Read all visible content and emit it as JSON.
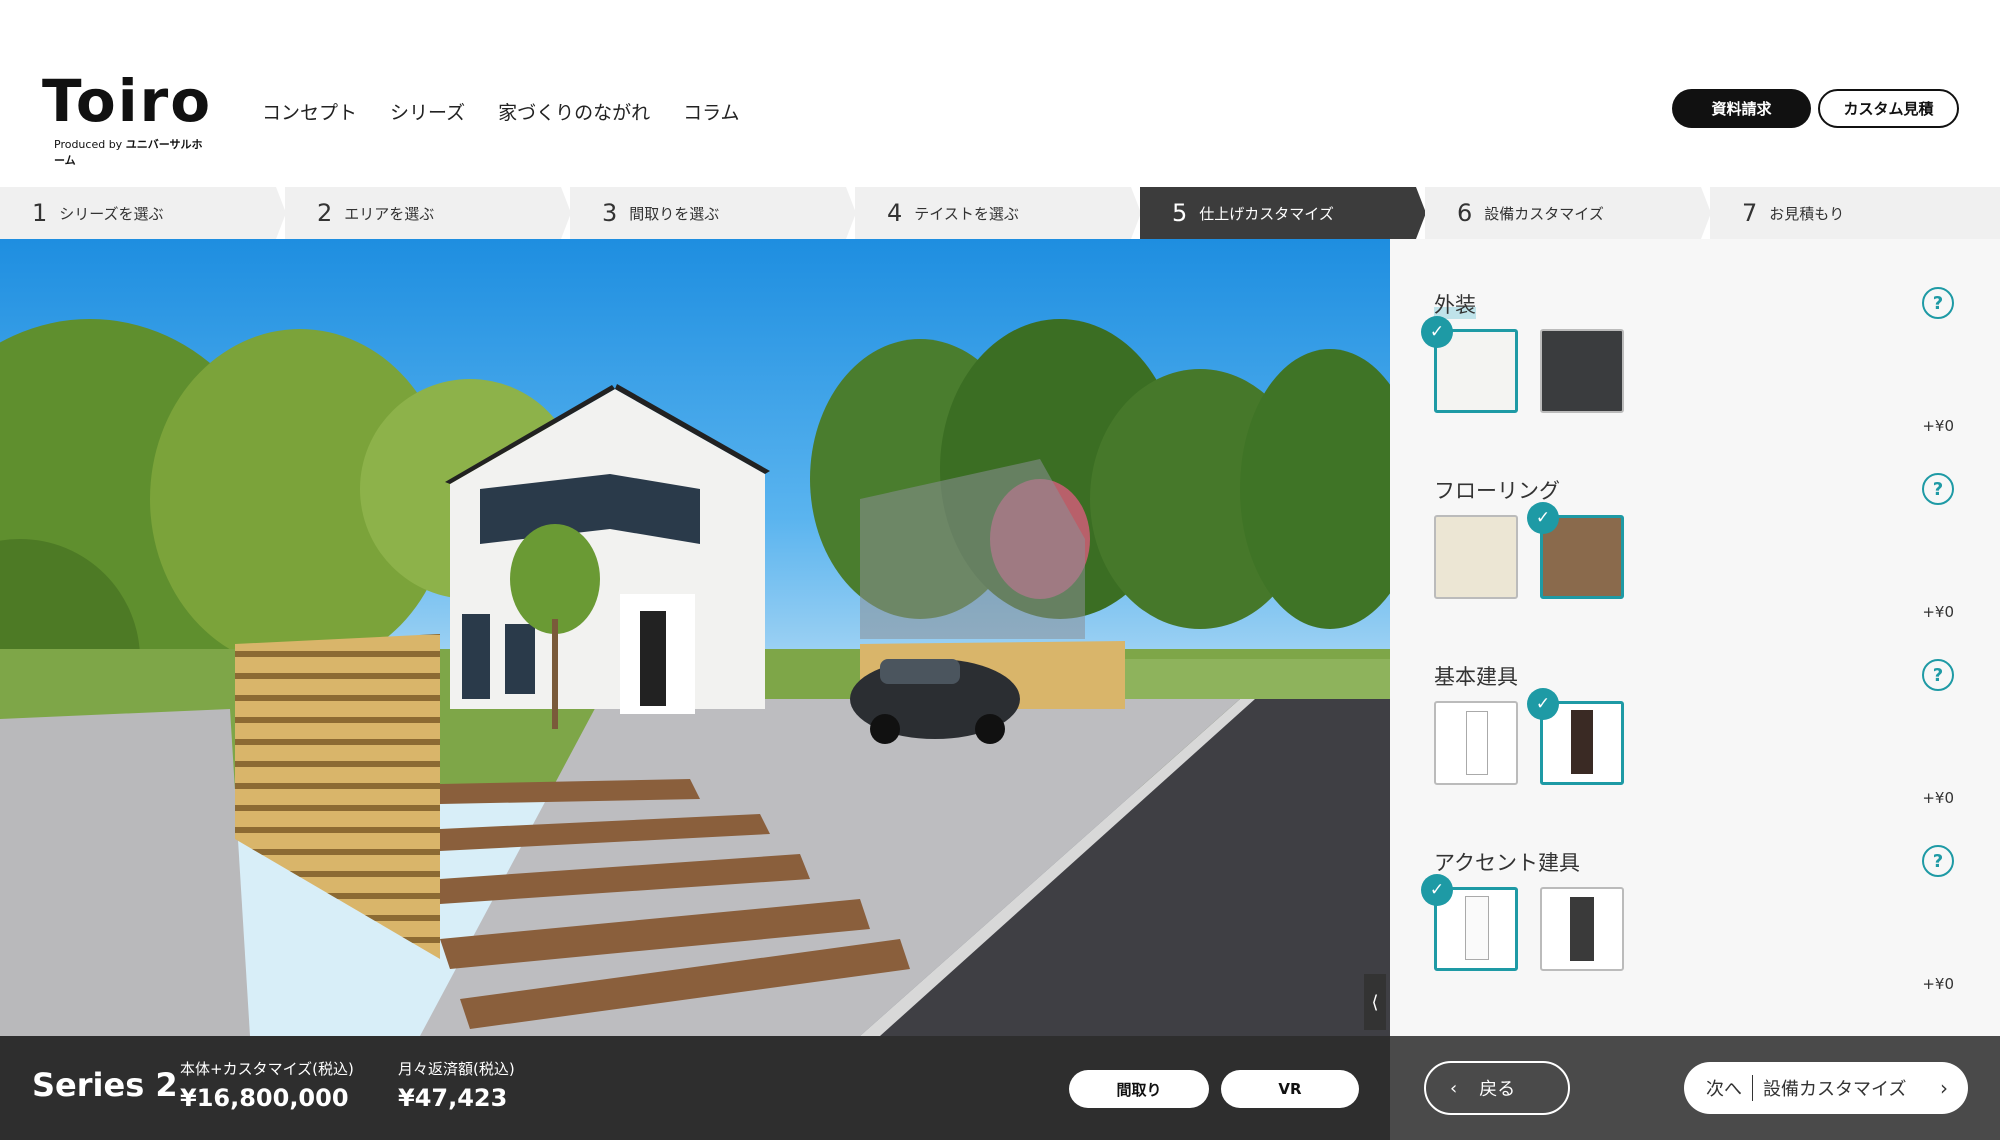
{
  "header": {
    "logo_text": "Toiro",
    "logo_sub_prefix": "Produced by",
    "logo_sub_brand": "ユニバーサルホーム",
    "nav": [
      "コンセプト",
      "シリーズ",
      "家づくりのながれ",
      "コラム"
    ],
    "doc_request": "資料請求",
    "custom_estimate": "カスタム見積"
  },
  "steps": [
    {
      "num": "1",
      "label": "シリーズを選ぶ"
    },
    {
      "num": "2",
      "label": "エリアを選ぶ"
    },
    {
      "num": "3",
      "label": "間取りを選ぶ"
    },
    {
      "num": "4",
      "label": "テイストを選ぶ"
    },
    {
      "num": "5",
      "label": "仕上げカスタマイズ"
    },
    {
      "num": "6",
      "label": "設備カスタマイズ"
    },
    {
      "num": "7",
      "label": "お見積もり"
    }
  ],
  "panel": {
    "sections": [
      {
        "title": "外装",
        "price": "+¥0"
      },
      {
        "title": "フローリング",
        "price": "+¥0"
      },
      {
        "title": "基本建具",
        "price": "+¥0"
      },
      {
        "title": "アクセント建具",
        "price": "+¥0"
      }
    ],
    "help_symbol": "?",
    "check_symbol": "✓"
  },
  "bottom": {
    "series": "Series 2",
    "total_label": "本体+カスタマイズ(税込)",
    "total_value": "¥16,800,000",
    "monthly_label": "月々返済額(税込)",
    "monthly_value": "¥47,423",
    "floorplan_button": "間取り",
    "vr_button": "VR",
    "back_button": "戻る",
    "next_prefix": "次へ",
    "next_label": "設備カスタマイズ"
  },
  "colors": {
    "accent": "#1e9aa5",
    "active_step": "#3c3c3c",
    "bottom_bar": "#2e2e2e"
  }
}
